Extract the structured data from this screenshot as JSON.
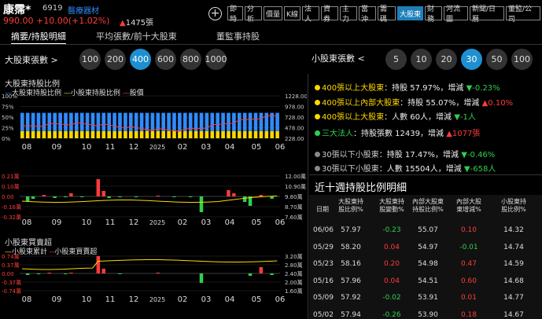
{
  "header": {
    "name": "康霈*",
    "code": "6919",
    "industry": "醫療器材",
    "price": "990.00",
    "change": "+10.00(+1.02%)",
    "volume": "1475張"
  },
  "tabs": [
    "即時",
    "分析",
    "價量",
    "K線",
    "法人",
    "資券",
    "主力",
    "當沖",
    "籌碼",
    "大股東",
    "財務",
    "河流圖",
    "新聞/日曆",
    "董監/公司"
  ],
  "subtabs": [
    "摘要/持股明細",
    "平均張數/前十大股東",
    "董監事持股"
  ],
  "big_holder": {
    "label": "大股東張數 >",
    "options": [
      "100",
      "200",
      "400",
      "600",
      "800",
      "1000"
    ],
    "selected": "400"
  },
  "small_holder": {
    "label": "小股東張數 <",
    "options": [
      "5",
      "10",
      "20",
      "30",
      "50",
      "100"
    ],
    "selected": "30"
  },
  "chart1": {
    "title": "大股東持股比例",
    "legend": [
      "大股東持股比例",
      "小股東持股比例",
      "股價"
    ],
    "left_ticks": [
      "100%",
      "75%",
      "50%",
      "25%",
      "0%"
    ],
    "right_ticks": [
      "1228.00",
      "978.00",
      "728.00",
      "478.00",
      "228.00"
    ],
    "x_ticks": [
      "08",
      "09",
      "10",
      "11",
      "12",
      "2025",
      "02",
      "03",
      "04",
      "05",
      "06"
    ]
  },
  "chart2": {
    "left_ticks": [
      "0.21萬",
      "0.10萬",
      "0.00",
      "-0.16萬",
      "-0.32萬"
    ],
    "right_ticks": [
      "12.00萬",
      "10.90萬",
      "9.80萬",
      "8.70萬",
      "7.60萬"
    ],
    "x_ticks": [
      "08",
      "09",
      "10",
      "11",
      "12",
      "2025",
      "02",
      "03",
      "04",
      "05",
      "06"
    ]
  },
  "chart3": {
    "title": "小股東買賣超",
    "legend": [
      "小股東累計",
      "小股東買賣超"
    ],
    "left_ticks": [
      "0.74萬",
      "0.37萬",
      "0.00",
      "-0.37萬",
      "-0.74萬"
    ],
    "right_ticks": [
      "3.20萬",
      "2.80萬",
      "2.40萬",
      "2.00萬",
      "1.60萬"
    ],
    "x_ticks": [
      "08",
      "09",
      "10",
      "11",
      "12",
      "2025",
      "02",
      "03",
      "04",
      "05",
      "06"
    ]
  },
  "summary": {
    "l1": {
      "label": "400張以上大股東",
      "text": "：持股 57.97%，增減",
      "delta": "-0.23%"
    },
    "l2": {
      "label": "400張以上內部大股東",
      "text": "：持股 55.07%，增減",
      "delta": "0.10%"
    },
    "l3": {
      "label": "400張以上大股東",
      "text": "：人數 60人，增減",
      "delta": "-1人"
    },
    "l4": {
      "label": "三大法人",
      "text": "：持股張數 12439，增減",
      "delta": "1077張"
    },
    "l5": {
      "label": "30張以下小股東",
      "text": "：持股 17.47%，增減",
      "delta": "-0.46%"
    },
    "l6": {
      "label": "30張以下小股東",
      "text": "：人數 15504人，增減",
      "delta": "-658人"
    }
  },
  "table": {
    "title": "近十週持股比例明細",
    "headers": [
      "日期",
      "大股東持股比例%",
      "大股東持股變動%",
      "內部大股東持股比例%",
      "內部大股東增減%",
      "小股東持股比例%"
    ],
    "rows": [
      [
        "06/06",
        "57.97",
        "-0.23",
        "55.07",
        "0.10",
        "14.32"
      ],
      [
        "05/29",
        "58.20",
        "0.04",
        "54.97",
        "-0.01",
        "14.74"
      ],
      [
        "05/23",
        "58.16",
        "0.20",
        "54.98",
        "0.47",
        "14.59"
      ],
      [
        "05/16",
        "57.96",
        "0.04",
        "54.51",
        "0.60",
        "14.68"
      ],
      [
        "05/09",
        "57.92",
        "-0.02",
        "53.91",
        "0.01",
        "14.77"
      ],
      [
        "05/02",
        "57.94",
        "-0.26",
        "53.90",
        "0.18",
        "14.67"
      ]
    ]
  },
  "colors": {
    "up": "#ff3b3b",
    "down": "#2fcf4f",
    "accent": "#1e8fd0",
    "yellow": "#ffd800",
    "blue_bar": "#2f8cff"
  }
}
